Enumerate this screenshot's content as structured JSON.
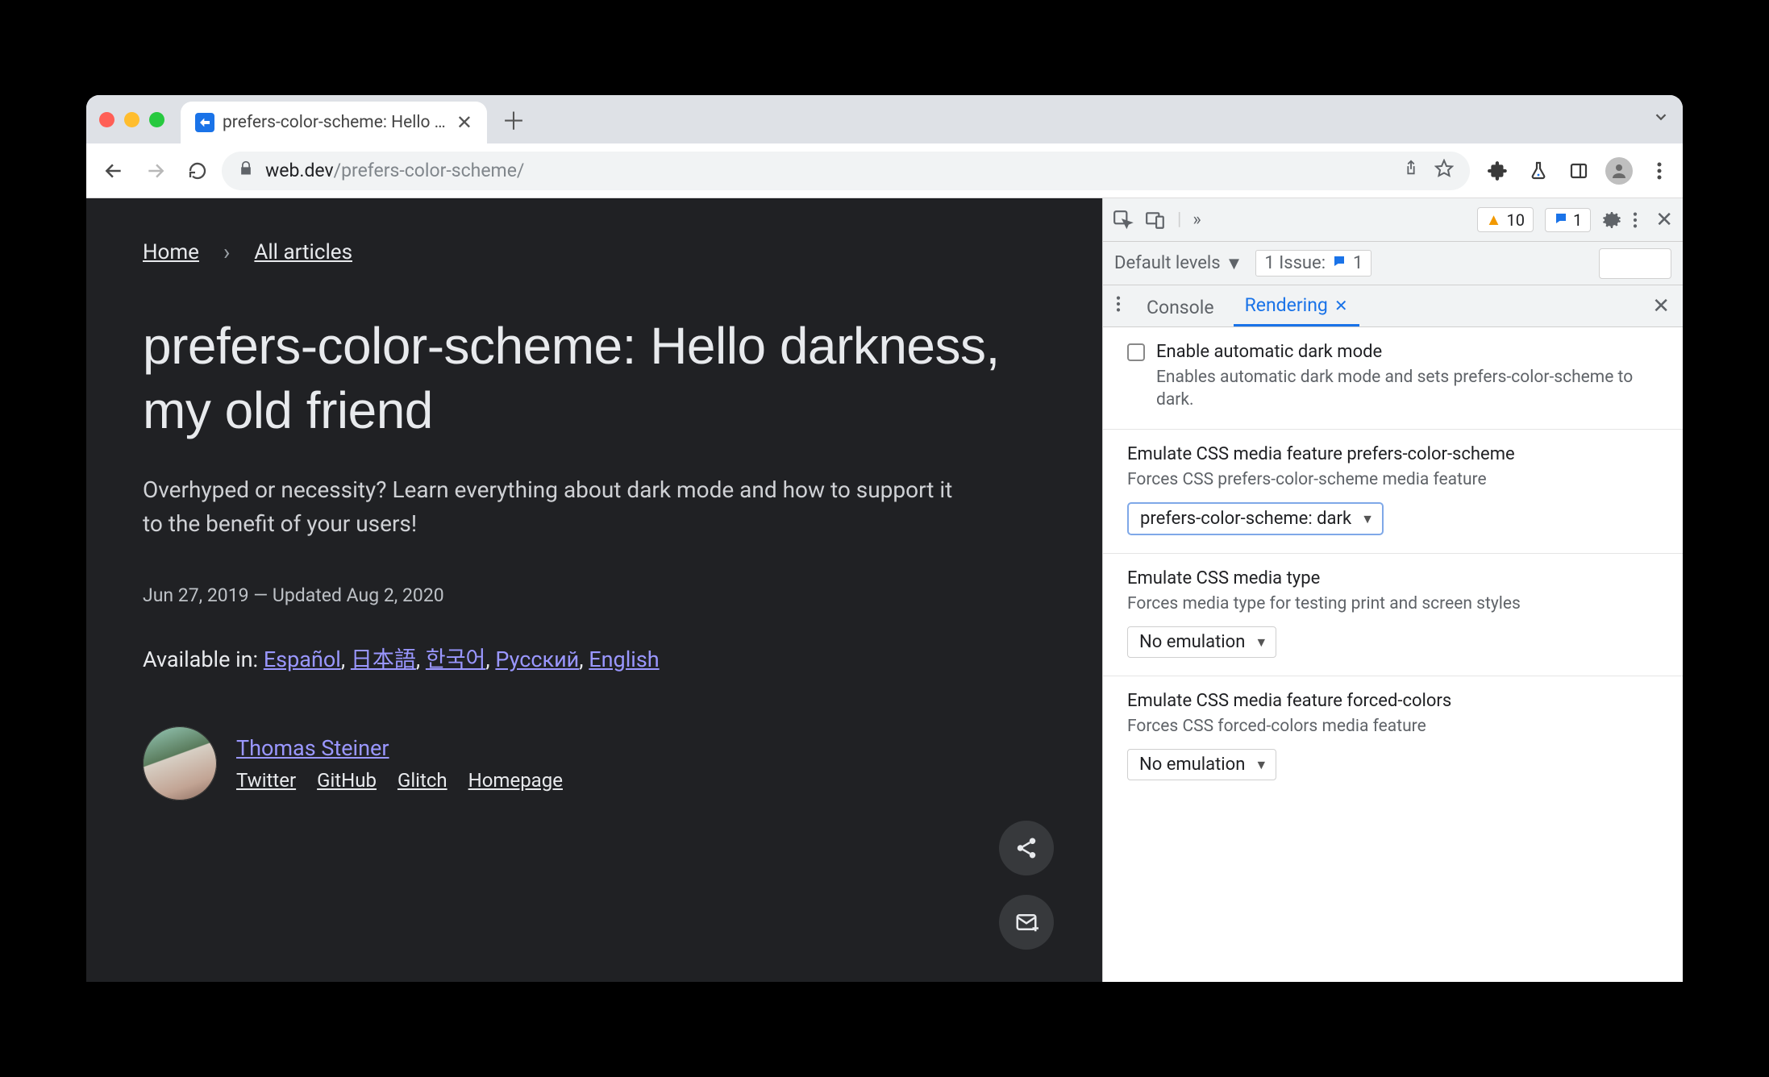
{
  "browser": {
    "tab_title": "prefers-color-scheme: Hello da",
    "url_host": "web.dev",
    "url_path": "/prefers-color-scheme/"
  },
  "page": {
    "breadcrumb": {
      "home": "Home",
      "all": "All articles"
    },
    "title": "prefers-color-scheme: Hello darkness, my old friend",
    "subtitle": "Overhyped or necessity? Learn everything about dark mode and how to support it to the benefit of your users!",
    "meta": "Jun 27, 2019 — Updated Aug 2, 2020",
    "available_label": "Available in:",
    "languages": [
      "Español",
      "日本語",
      "한국어",
      "Русский",
      "English"
    ],
    "author": {
      "name": "Thomas Steiner",
      "links": [
        "Twitter",
        "GitHub",
        "Glitch",
        "Homepage"
      ]
    }
  },
  "devtools": {
    "warnings_count": "10",
    "messages_count": "1",
    "levels_label": "Default levels",
    "issues_label": "1 Issue:",
    "issues_count": "1",
    "tabs": {
      "console": "Console",
      "rendering": "Rendering"
    },
    "sections": {
      "auto_dark": {
        "title": "Enable automatic dark mode",
        "desc": "Enables automatic dark mode and sets prefers-color-scheme to dark."
      },
      "prefers_scheme": {
        "title": "Emulate CSS media feature prefers-color-scheme",
        "desc": "Forces CSS prefers-color-scheme media feature",
        "value": "prefers-color-scheme: dark"
      },
      "media_type": {
        "title": "Emulate CSS media type",
        "desc": "Forces media type for testing print and screen styles",
        "value": "No emulation"
      },
      "forced_colors": {
        "title": "Emulate CSS media feature forced-colors",
        "desc": "Forces CSS forced-colors media feature",
        "value": "No emulation"
      }
    }
  }
}
